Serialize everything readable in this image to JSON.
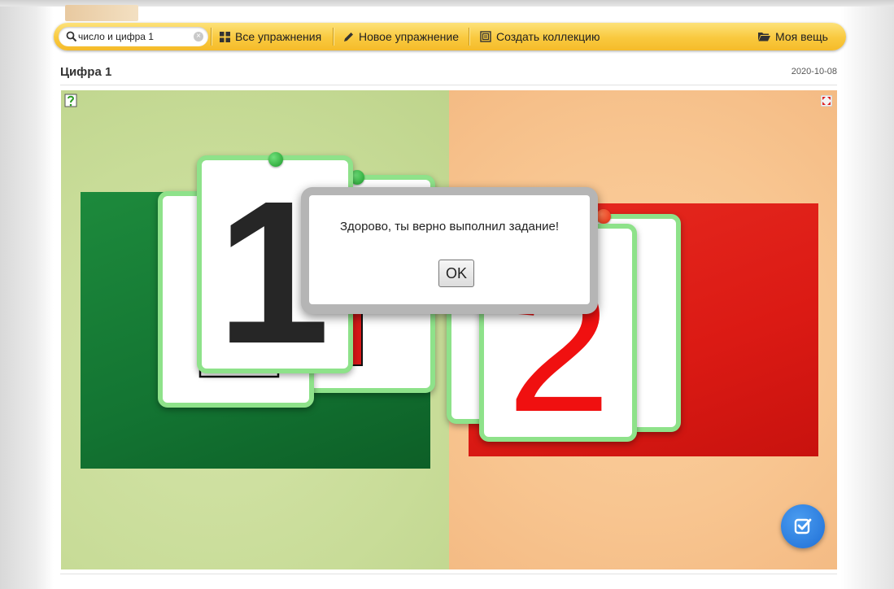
{
  "toolbar": {
    "search_value": "число и цифра 1",
    "all_exercises": "Все упражнения",
    "new_exercise": "Новое упражнение",
    "create_collection": "Создать коллекцию",
    "my_stuff": "Моя вещь"
  },
  "page": {
    "title": "Цифра 1",
    "date": "2020-10-08"
  },
  "exercise": {
    "card_left_front_digit": "1",
    "card_right_front_digit": "2",
    "zone_colors": {
      "left_background": "#c8dc98",
      "right_background": "#f8c590",
      "left_zone": "#137432",
      "right_zone": "#db1a14",
      "card_border": "#8ee28a"
    },
    "icons": {
      "help": "help-question-icon",
      "fullscreen": "fullscreen-icon",
      "check": "check-square-icon"
    }
  },
  "dialog": {
    "message": "Здорово, ты верно выполнил задание!",
    "ok_label": "OK"
  }
}
